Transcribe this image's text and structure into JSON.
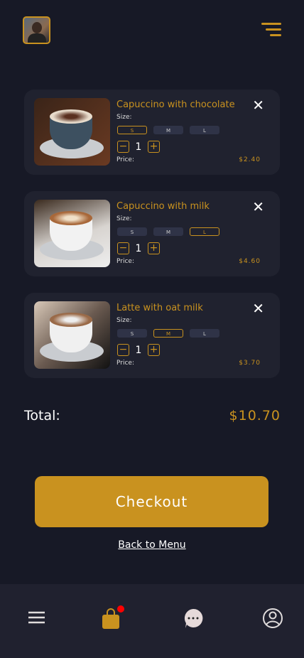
{
  "header": {
    "avatar": "user-avatar",
    "menu_icon": "menu-icon"
  },
  "cart": [
    {
      "title": "Capuccino with chocolate",
      "size_label": "Size:",
      "sizes": [
        "S",
        "M",
        "L"
      ],
      "selected": "S",
      "qty": "1",
      "price_label": "Price:",
      "price": "$2.40"
    },
    {
      "title": "Capuccino with milk",
      "size_label": "Size:",
      "sizes": [
        "S",
        "M",
        "L"
      ],
      "selected": "L",
      "qty": "1",
      "price_label": "Price:",
      "price": "$4.60"
    },
    {
      "title": "Latte with oat milk",
      "size_label": "Size:",
      "sizes": [
        "S",
        "M",
        "L"
      ],
      "selected": "M",
      "qty": "1",
      "price_label": "Price:",
      "price": "$3.70"
    }
  ],
  "summary": {
    "total_label": "Total:",
    "total": "$10.70"
  },
  "actions": {
    "checkout": "Checkout",
    "back": "Back to Menu"
  },
  "nav": [
    "menu-icon",
    "shopping-bag-icon",
    "chat-icon",
    "profile-icon"
  ],
  "colors": {
    "accent": "#c9921f",
    "background": "#171926",
    "card": "#20222f",
    "badge": "#ff0000"
  }
}
